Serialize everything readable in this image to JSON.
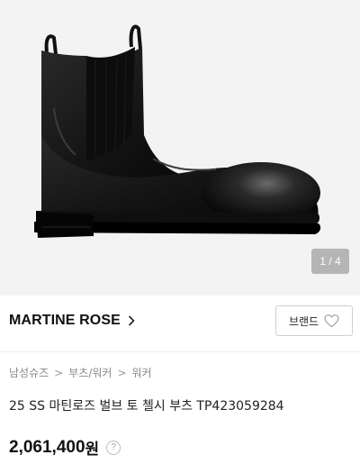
{
  "gallery": {
    "image_alt": "black leather chelsea boot",
    "counter": "1 / 4"
  },
  "brand": {
    "name": "MARTINE ROSE",
    "button_label": "브랜드",
    "chevron_icon": "chevron-right-icon",
    "like_icon": "heart-outline-icon"
  },
  "breadcrumb": {
    "items": [
      "남성슈즈",
      "부츠/워커",
      "워커"
    ],
    "separator": ">"
  },
  "product": {
    "title": "25 SS 마틴로즈 벌브 토 첼시 부츠 TP423059284",
    "price": "2,061,400",
    "price_unit": "원",
    "help_symbol": "?"
  },
  "colors": {
    "gallery_bg": "#f3f3f3",
    "text": "#222222",
    "muted": "#8a8a8a",
    "border": "#cfcfcf"
  }
}
